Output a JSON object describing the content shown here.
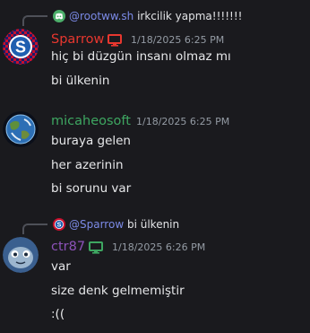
{
  "messages": [
    {
      "reply": {
        "mention": "@rootww.sh",
        "content": "irkcilik yapma!!!!!!!"
      },
      "username": "Sparrow",
      "username_color": "#e8372f",
      "timestamp": "1/18/2025 6:25 PM",
      "lines": [
        "hiç bi düzgün insanı olmaz mı",
        "bi ülkenin"
      ]
    },
    {
      "username": "micaheosoft",
      "username_color": "#3ea661",
      "timestamp": "1/18/2025 6:25 PM",
      "lines": [
        "buraya gelen",
        "her azerinin",
        "bi sorunu var"
      ]
    },
    {
      "reply": {
        "mention": "@Sparrow",
        "content": "bi ülkenin"
      },
      "username": "ctr87",
      "username_color": "#8c52b8",
      "timestamp": "1/18/2025 6:26 PM",
      "lines": [
        "var",
        "size denk gelmemiştir",
        ":(("
      ]
    }
  ],
  "icons": {
    "discord": "discord-icon",
    "desktop_red": "desktop-icon",
    "desktop_green": "desktop-icon"
  },
  "colors": {
    "background": "#1a1a1e",
    "mention": "#7b8ae6",
    "timestamp": "#949ba4"
  }
}
